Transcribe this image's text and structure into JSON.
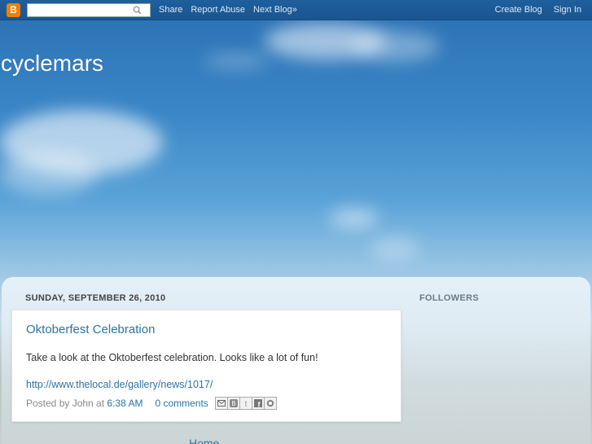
{
  "navbar": {
    "logo_letter": "B",
    "search_placeholder": "",
    "links": [
      "Share",
      "Report Abuse",
      "Next Blog»"
    ],
    "right_links": [
      "Create Blog",
      "Sign In"
    ]
  },
  "blog": {
    "title": "cyclemars"
  },
  "post": {
    "date_header": "SUNDAY, SEPTEMBER 26, 2010",
    "title": "Oktoberfest Celebration",
    "body": "Take a look at the Oktoberfest celebration.  Looks like a lot of fun!",
    "link": "http://www.thelocal.de/gallery/news/1017/",
    "posted_by_prefix": "Posted by John at",
    "time": "6:38 AM",
    "comments": "0 comments",
    "share_icons": [
      "email-icon",
      "blogthis-icon",
      "twitter-icon",
      "facebook-icon",
      "buzz-icon"
    ]
  },
  "sidebar": {
    "followers_title": "FOLLOWERS"
  },
  "footer": {
    "home_link": "Home"
  },
  "colors": {
    "navbar": "#1a5590",
    "link": "#2b74a6",
    "logo": "#f57d00"
  }
}
